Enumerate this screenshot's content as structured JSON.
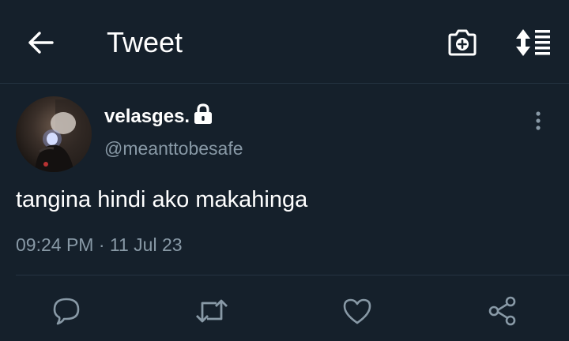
{
  "header": {
    "title": "Tweet",
    "back_icon": "arrow-left-icon",
    "camera_icon": "camera-add-icon",
    "sort_icon": "sort-list-icon"
  },
  "tweet": {
    "display_name": "velasges.",
    "protected_icon": "lock-icon",
    "handle": "@meanttobesafe",
    "text": "tangina hindi ako makahinga",
    "timestamp": "09:24 PM · 11 Jul 23"
  },
  "actions": [
    {
      "name": "reply",
      "icon": "reply-icon"
    },
    {
      "name": "retweet",
      "icon": "retweet-icon"
    },
    {
      "name": "like",
      "icon": "heart-icon"
    },
    {
      "name": "share",
      "icon": "share-icon"
    }
  ],
  "colors": {
    "background": "#15202b",
    "divider": "#253341",
    "primary_text": "#ffffff",
    "secondary_text": "#8899a6"
  }
}
